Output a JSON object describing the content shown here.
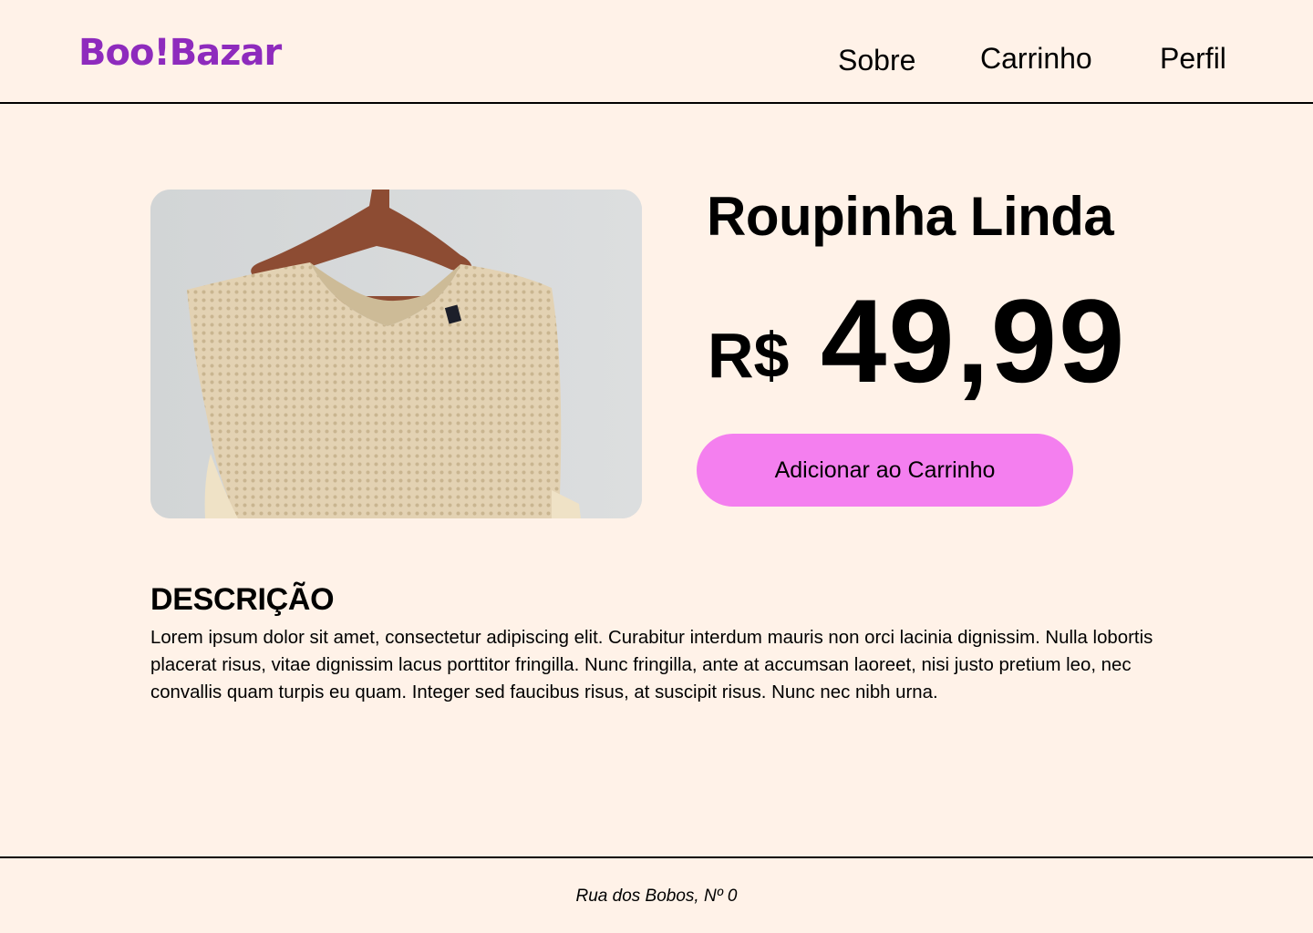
{
  "header": {
    "logo_text": "Boo!Bazar",
    "nav": {
      "about_label": "Sobre",
      "cart_label": "Carrinho",
      "profile_label": "Perfil"
    }
  },
  "product": {
    "title": "Roupinha Linda",
    "currency": "R$",
    "price": "49,99",
    "add_to_cart_label": "Adicionar ao Carrinho",
    "image_subject": "beige knit sweater on wooden hanger"
  },
  "description": {
    "heading": "DESCRIÇÃO",
    "body": "Lorem ipsum dolor sit amet, consectetur adipiscing elit. Curabitur interdum mauris non orci lacinia dignissim. Nulla lobortis placerat risus, vitae dignissim lacus porttitor fringilla. Nunc fringilla, ante at accumsan laoreet, nisi justo pretium leo, nec convallis quam turpis eu quam. Integer sed faucibus risus, at suscipit risus. Nunc nec nibh urna."
  },
  "footer": {
    "address": "Rua dos Bobos, Nº 0"
  },
  "colors": {
    "background": "#fff2e8",
    "brand": "#8e2bbd",
    "button": "#f47fef",
    "text": "#000000"
  }
}
